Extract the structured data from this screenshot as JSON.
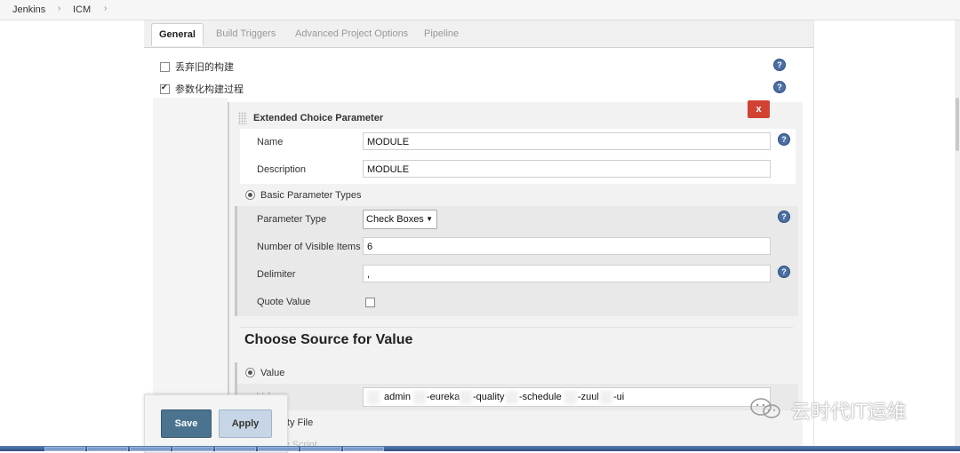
{
  "breadcrumb": {
    "items": [
      "Jenkins",
      "ICM"
    ],
    "separator": "›"
  },
  "tabs": [
    "General",
    "Build Triggers",
    "Advanced Project Options",
    "Pipeline"
  ],
  "general": {
    "discard_builds_label": "丢弃旧的构建",
    "discard_builds_checked": false,
    "parameterized_label": "参数化构建过程",
    "parameterized_checked": true,
    "help_glyph": "?"
  },
  "parameter": {
    "title": "Extended Choice Parameter",
    "delete_label": "x",
    "name_label": "Name",
    "name_value": "MODULE",
    "description_label": "Description",
    "description_value": "MODULE",
    "basic_types_label": "Basic Parameter Types",
    "parameter_type_label": "Parameter Type",
    "parameter_type_value": "Check Boxes",
    "visible_items_label": "Number of Visible Items",
    "visible_items_value": "6",
    "delimiter_label": "Delimiter",
    "delimiter_value": ",",
    "quote_value_label": "Quote Value",
    "quote_value_checked": false
  },
  "source": {
    "heading": "Choose Source for Value",
    "value_radio_label": "Value",
    "value_label": "Value",
    "value_tokens": [
      "admin",
      "-eureka",
      "-quality",
      "-schedule",
      "-zuul",
      "-ui"
    ],
    "property_file_label": "perty File",
    "groovy_label": "Groovy Script"
  },
  "actions": {
    "save": "Save",
    "apply": "Apply"
  },
  "watermark": {
    "text": "云时代IT运维"
  },
  "colors": {
    "save_bg": "#4a7390",
    "apply_bg": "#c7d6e6",
    "delete_bg": "#d24232",
    "help_bg": "#4a6fa5"
  }
}
